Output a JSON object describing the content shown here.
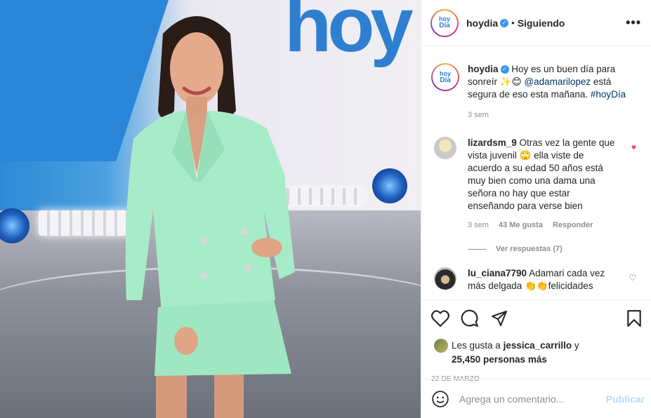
{
  "post": {
    "username": "hoydia",
    "follow_state": "Siguiendo",
    "avatar_text": [
      "hoy",
      "Día"
    ],
    "photo_logo": "hoy",
    "more_options": "•••"
  },
  "caption": {
    "username": "hoydia",
    "text_before": " Hoy es un buen día para sonreír ✨😊 ",
    "mention": "@adamarilopez",
    "text_after": " está segura de eso esta mañana. ",
    "hashtag": "#hoyDía",
    "time": "3 sem"
  },
  "comments": [
    {
      "username": "lizardsm_9",
      "text": " Otras vez la gente que vista juvenil 🙄 ella viste de acuerdo a su edad 50 años está muy bien como una dama una señora no hay que estar enseñando para verse bien",
      "time": "3 sem",
      "likes": "43 Me gusta",
      "reply": "Responder",
      "view_replies": "Ver respuestas (7)",
      "liked": true
    },
    {
      "username": "lu_ciana7790",
      "text": " Adamari cada vez más delgada 👏👏felicidades",
      "liked": false
    }
  ],
  "likes": {
    "prefix": "Les gusta a ",
    "user": "jessica_carrillo",
    "suffix": " y",
    "count": "25,450 personas más"
  },
  "date": "22 DE MARZO",
  "add_comment": {
    "placeholder": "Agrega un comentario...",
    "publish": "Publicar"
  },
  "colors": {
    "accent": "#3897f0",
    "heart": "#ed4956",
    "publish_disabled": "#b3dbff"
  }
}
